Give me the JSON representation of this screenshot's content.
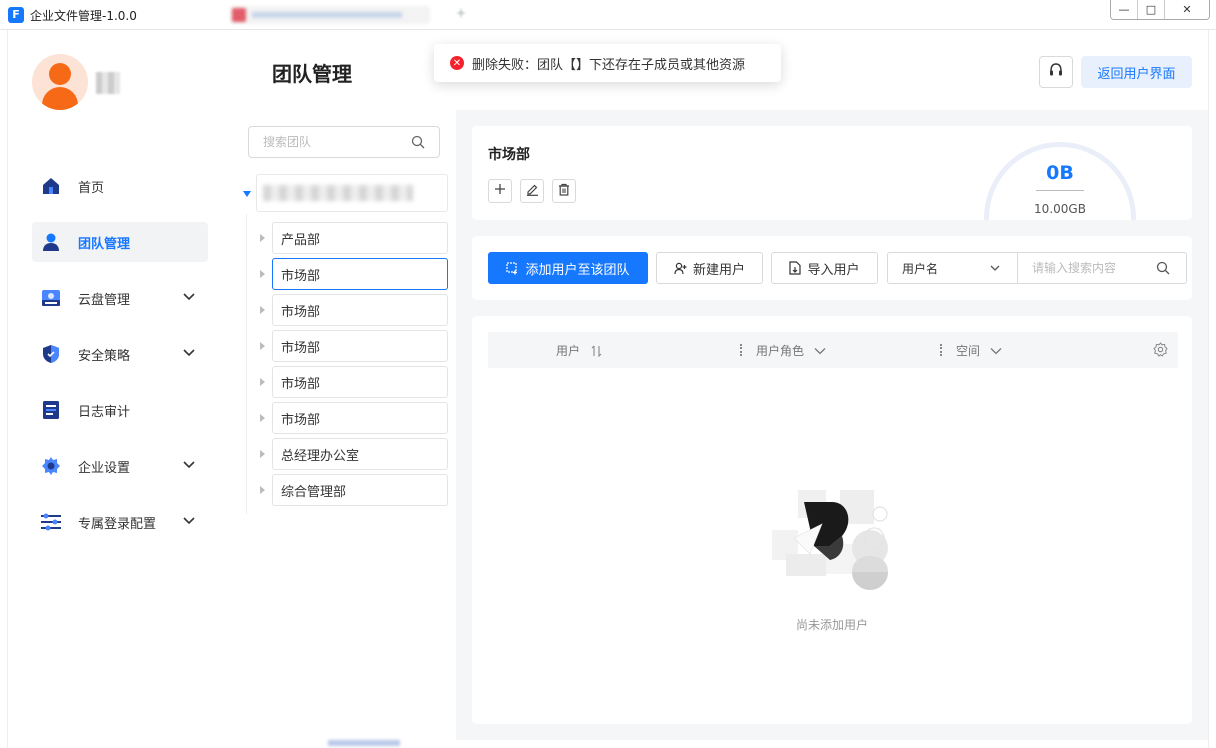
{
  "window": {
    "title": "企业文件管理-1.0.0",
    "controls": {
      "minimize": "—",
      "maximize": "□",
      "close": "✕"
    }
  },
  "sidebar": {
    "items": [
      {
        "label": "首页",
        "icon": "home-icon",
        "active": false,
        "expandable": false
      },
      {
        "label": "团队管理",
        "icon": "user-icon",
        "active": true,
        "expandable": false
      },
      {
        "label": "云盘管理",
        "icon": "cloud-drive-icon",
        "active": false,
        "expandable": true
      },
      {
        "label": "安全策略",
        "icon": "shield-icon",
        "active": false,
        "expandable": true
      },
      {
        "label": "日志审计",
        "icon": "log-icon",
        "active": false,
        "expandable": false
      },
      {
        "label": "企业设置",
        "icon": "gear-icon",
        "active": false,
        "expandable": true
      },
      {
        "label": "专属登录配置",
        "icon": "sliders-icon",
        "active": false,
        "expandable": true
      }
    ]
  },
  "page": {
    "title": "团队管理"
  },
  "team_tree": {
    "search_placeholder": "搜索团队",
    "nodes": [
      {
        "label": "产品部",
        "selected": false
      },
      {
        "label": "市场部",
        "selected": true
      },
      {
        "label": "市场部",
        "selected": false
      },
      {
        "label": "市场部",
        "selected": false
      },
      {
        "label": "市场部",
        "selected": false
      },
      {
        "label": "市场部",
        "selected": false
      },
      {
        "label": "总经理办公室",
        "selected": false
      },
      {
        "label": "综合管理部",
        "selected": false
      }
    ]
  },
  "header": {
    "back_button": "返回用户界面"
  },
  "toast": {
    "message": "删除失败：团队【】下还存在子成员或其他资源",
    "icon_text": "✕"
  },
  "info_card": {
    "dept_name": "市场部",
    "storage_used": "0B",
    "storage_total": "10.00GB"
  },
  "toolbar": {
    "add_to_team": "添加用户至该团队",
    "new_user": "新建用户",
    "import_user": "导入用户",
    "search_field": "用户名",
    "search_placeholder": "请输入搜索内容"
  },
  "table": {
    "columns": [
      "用户",
      "用户角色",
      "空间"
    ],
    "empty_text": "尚未添加用户"
  },
  "colors": {
    "accent": "#1677ff",
    "error": "#f5222d",
    "avatar": "#f66a17"
  }
}
